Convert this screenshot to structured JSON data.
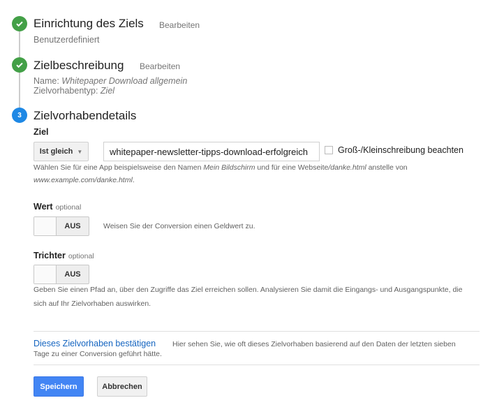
{
  "steps": [
    {
      "title": "Einrichtung des Ziels",
      "edit": "Bearbeiten",
      "summary": "Benutzerdefiniert"
    },
    {
      "title": "Zielbeschreibung",
      "edit": "Bearbeiten",
      "name_label": "Name:",
      "name_value": "Whitepaper Download allgemein",
      "type_label": "Zielvorhabentyp:",
      "type_value": "Ziel"
    },
    {
      "number": "3",
      "title": "Zielvorhabendetails"
    }
  ],
  "ziel": {
    "label": "Ziel",
    "match_type": "Ist gleich",
    "value": "whitepaper-newsletter-tipps-download-erfolgreich",
    "case_label": "Groß-/Kleinschreibung beachten",
    "case_checked": false,
    "help_1": "Wählen Sie für eine App beispielsweise den Namen ",
    "help_em1": "Mein Bildschirm",
    "help_2": " und für eine Webseite",
    "help_em2": "/danke.html",
    "help_3": " anstelle von",
    "help_em3": "www.example.com/danke.html",
    "help_4": "."
  },
  "wert": {
    "label": "Wert",
    "optional": "optional",
    "toggle": "AUS",
    "description": "Weisen Sie der Conversion einen Geldwert zu."
  },
  "trichter": {
    "label": "Trichter",
    "optional": "optional",
    "toggle": "AUS",
    "description_1": "Geben Sie einen Pfad an, über den Zugriffe das Ziel erreichen sollen. Analysieren Sie damit die Eingangs- und Ausgangspunkte, die",
    "description_2": "sich auf Ihr Zielvorhaben auswirken."
  },
  "verify": {
    "link": "Dieses Zielvorhaben bestätigen",
    "text_1": "Hier sehen Sie, wie oft dieses Zielvorhaben basierend auf den Daten der letzten sieben",
    "text_2": "Tage zu einer Conversion geführt hätte."
  },
  "buttons": {
    "save": "Speichern",
    "cancel": "Abbrechen"
  },
  "colors": {
    "complete": "#43a047",
    "active": "#1e88e5",
    "primary": "#4285f4",
    "link": "#1565c0"
  }
}
